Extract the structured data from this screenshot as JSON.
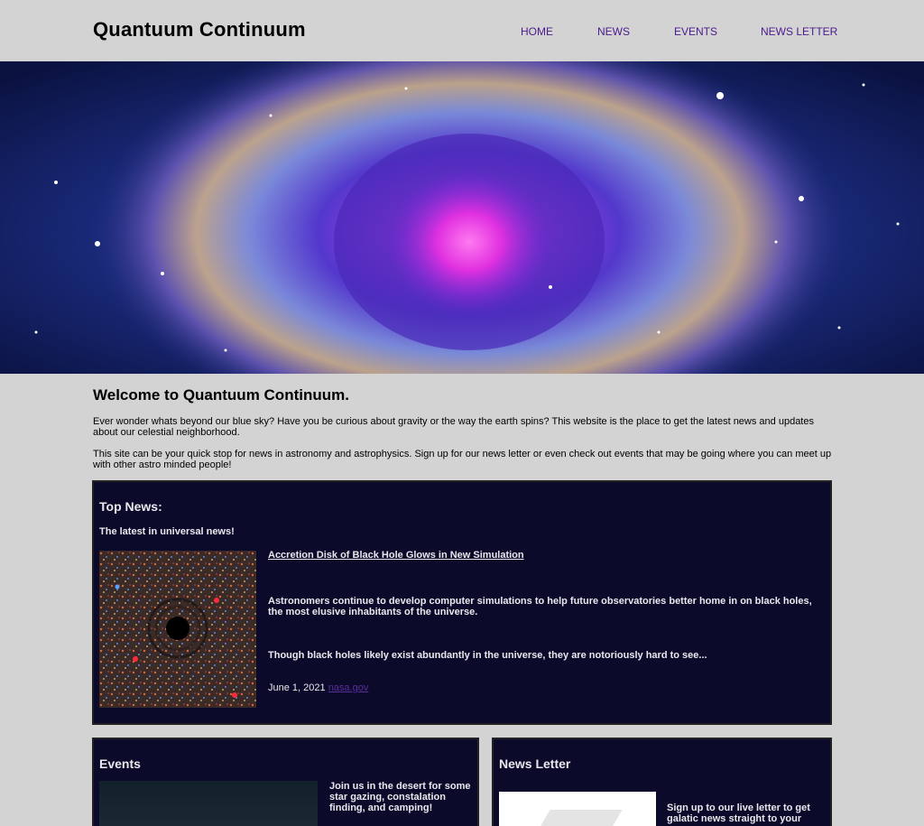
{
  "site": {
    "title": "Quantuum Continuum"
  },
  "nav": {
    "items": [
      "HOME",
      "NEWS",
      "EVENTS",
      "NEWS LETTER"
    ]
  },
  "welcome": {
    "title": "Welcome to Quantuum Continuum.",
    "p1": "Ever wonder whats beyond our blue sky? Have you be curious about gravity or the way the earth spins? This website is the place to get the latest news and updates about our celestial neighborhood.",
    "p2": "This site can be your quick stop for news in astronomy and astrophysics. Sign up for our news letter or even check out events that may be going where you can meet up with other astro minded people!"
  },
  "top_news": {
    "title": "Top News:",
    "subtitle": "The latest in universal news!",
    "article_title": "Accretion Disk of Black Hole Glows in New Simulation",
    "text1": "Astronomers continue to develop computer simulations to help future observatories better home in on black holes, the most elusive inhabitants of the universe.",
    "text2": "Though black holes likely exist abundantly in the universe, they are notoriously hard to see...",
    "date": "June 1, 2021",
    "source": "nasa.gov"
  },
  "events": {
    "title": "Events",
    "text": "Join us in the desert for some star gazing, constalation finding, and camping!"
  },
  "newsletter": {
    "title": "News Letter",
    "text": "Sign up to our live letter to get galatic news straight to your"
  },
  "colors": {
    "background": "#d3d3d3",
    "panel": "#0b0a2a",
    "nav_link": "#4b1a8c",
    "source_link": "#5b2e9a"
  }
}
